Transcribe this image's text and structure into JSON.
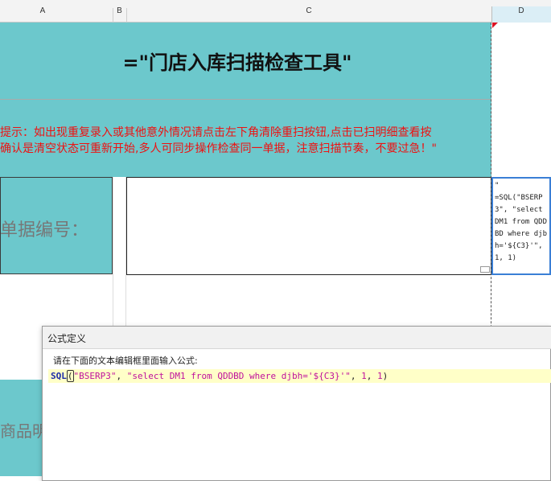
{
  "columns": [
    "A",
    "B",
    "C",
    "D"
  ],
  "sheet": {
    "title": "=\"门店入库扫描检查工具\"",
    "notice_line1": "提示：如出现重复录入或其他意外情况请点击左下角清除重扫按钮,点击已扫明细查看按",
    "notice_line2": "确认是清空状态可重新开始,多人可同步操作检查同一单据，注意扫描节奏，不要过急！\"",
    "doc_no_label": "单据编号：",
    "goods_label": "商品明",
    "d3_formula": "\"\n=SQL(\"BSERP3\", \"select DM1 from QDDBD where djbh='${C3}'\", 1, 1)"
  },
  "dialog": {
    "title": "公式定义",
    "hint": "请在下面的文本编辑框里面输入公式:",
    "formula": {
      "func": "SQL",
      "open": "(",
      "arg1": "\"BSERP3\"",
      "sep1": ", ",
      "arg2": "\"select DM1 from QDDBD where djbh='${C3}'\"",
      "sep2": ", ",
      "arg3": "1",
      "sep3": ", ",
      "arg4": "1",
      "close": ")"
    }
  },
  "colors": {
    "teal": "#6cc8cc",
    "notice_red": "#e11111",
    "selection_blue": "#3a7fd6",
    "editor_highlight": "#ffffc8"
  }
}
